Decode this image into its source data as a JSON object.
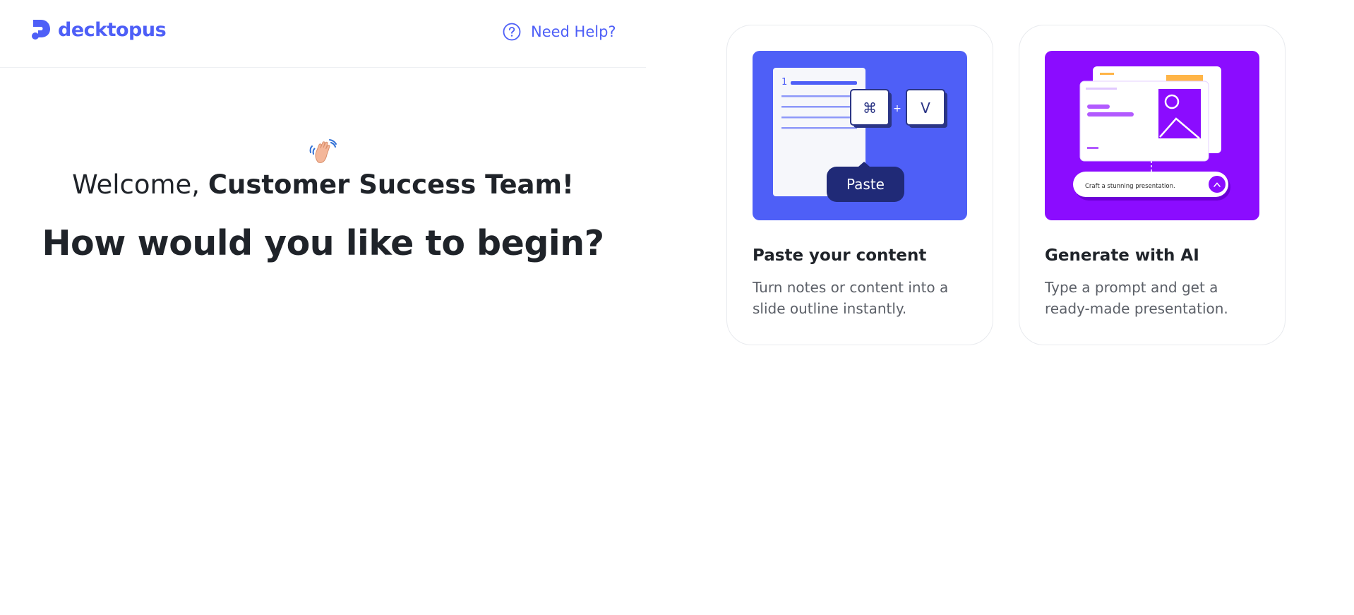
{
  "brand": {
    "name": "decktopus",
    "color": "#4e5ff7"
  },
  "header": {
    "help_label": "Need Help?",
    "help_icon": "question-circle-icon"
  },
  "welcome": {
    "greeting": "Welcome,",
    "name": "Customer Success Team!",
    "emoji": "waving-hand",
    "headline": "How would you like to begin?"
  },
  "cards": [
    {
      "id": "paste",
      "title": "Paste your content",
      "description": "Turn notes or content into a slide outline instantly.",
      "illustration": {
        "background": "#4e5ff7",
        "line_number": "1",
        "key_cmd": "⌘",
        "plus": "+",
        "key_v": "V",
        "tooltip": "Paste"
      }
    },
    {
      "id": "ai",
      "title": "Generate with AI",
      "description": "Type a prompt and get a ready-made presentation.",
      "illustration": {
        "background": "#8b0cff",
        "prompt_text": "Craft a stunning presentation.",
        "accent": "#ffb547"
      }
    }
  ]
}
